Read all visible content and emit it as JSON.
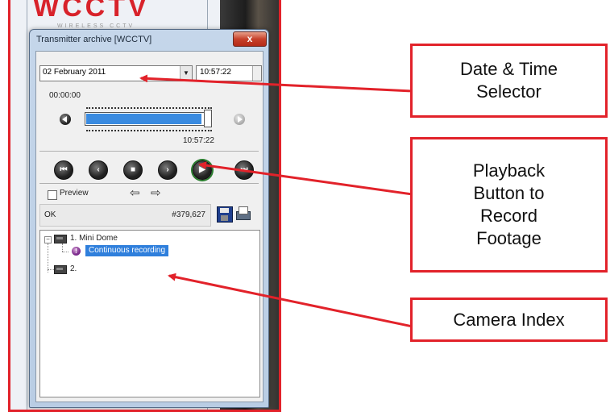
{
  "dialog": {
    "title": "Transmitter archive [WCCTV]",
    "close_glyph": "x"
  },
  "logo": {
    "text": "WCCTV",
    "subtitle": "WIRELESS CCTV"
  },
  "date_selector": {
    "date_value": "02  February  2011",
    "time_value": "10:57:22"
  },
  "timeline": {
    "start_time": "00:00:00",
    "end_time": "10:57:22",
    "position": 0.98
  },
  "controls": {
    "skip_back_icon": "skip-back-icon",
    "rewind_icon": "rewind-icon",
    "stop_icon": "stop-icon",
    "forward_icon": "forward-icon",
    "record_play_icon": "play-icon",
    "skip_forward_icon": "skip-forward-icon"
  },
  "preview": {
    "label": "Preview",
    "checked": false
  },
  "status": {
    "text": "OK",
    "count": "#379,627"
  },
  "tree": {
    "items": [
      {
        "label": "1. Mini Dome",
        "children": [
          {
            "label": "Continuous recording"
          }
        ]
      },
      {
        "label": "2."
      }
    ]
  },
  "callouts": {
    "date_time": [
      "Date & Time",
      "Selector"
    ],
    "playback": [
      "Playback",
      "Button to",
      "Record",
      "Footage"
    ],
    "camera_index": [
      "Camera Index"
    ]
  },
  "colors": {
    "accent_red": "#e2222a",
    "selection_blue": "#2f7fdc",
    "timeline_blue": "#3a8be0"
  }
}
